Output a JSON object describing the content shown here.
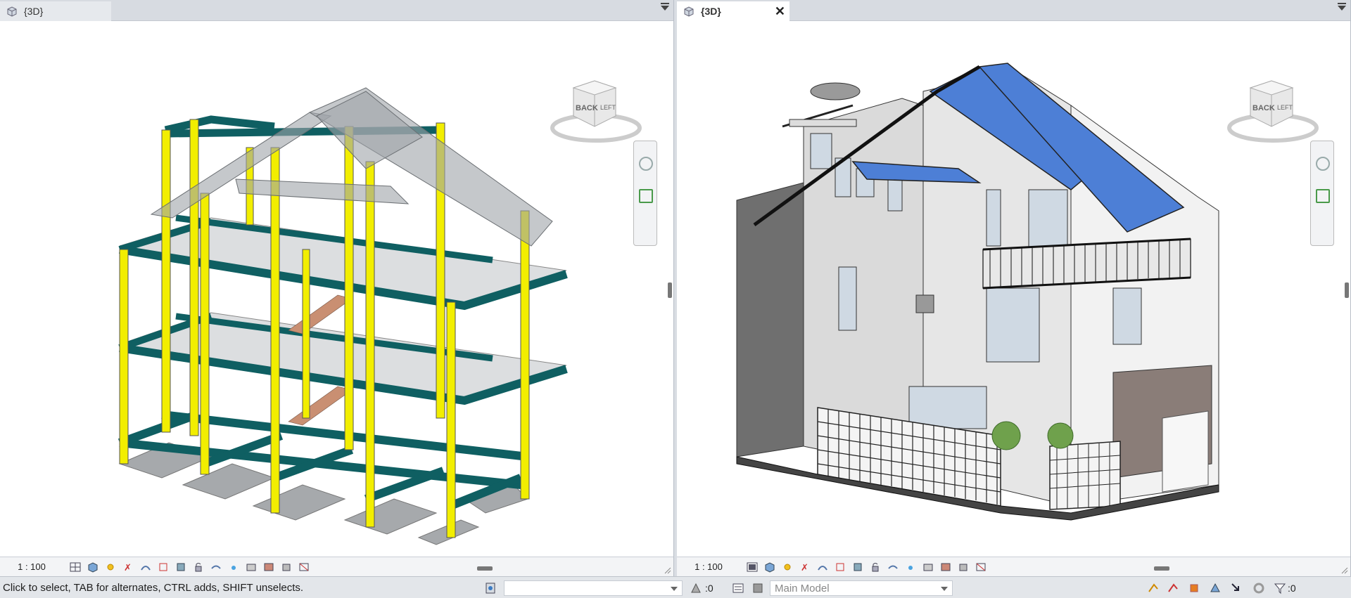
{
  "left_view": {
    "tab_label": "{3D}",
    "scale": "1 : 100",
    "viewcube": {
      "face_back": "BACK",
      "face_left": "LEFT"
    }
  },
  "right_view": {
    "tab_label": "{3D}",
    "close_glyph": "✕",
    "scale": "1 : 100",
    "viewcube": {
      "face_back": "BACK",
      "face_left": "LEFT"
    }
  },
  "view_control_icons": [
    "detail-level-icon",
    "visual-style-icon",
    "sun-path-icon",
    "shadows-icon",
    "render-icon",
    "crop-view-icon",
    "show-crop-icon",
    "unlock-3d-icon",
    "temporary-hide-icon",
    "reveal-hidden-icon",
    "temporary-properties-icon",
    "worksharing-display-icon",
    "reveal-constraints-icon",
    "analytical-model-icon",
    "highlight-displacement-icon"
  ],
  "statusbar": {
    "message": "Click to select, TAB for alternates, CTRL adds, SHIFT unselects.",
    "workset_value": "",
    "selection_count": ":0",
    "design_option": "Main Model",
    "filter_count": ":0"
  },
  "colors": {
    "column_yellow": "#f2ee00",
    "beam_teal": "#0f5f62",
    "roof_blue": "#4d7fd6",
    "slab_gray": "#9ea3a8"
  }
}
